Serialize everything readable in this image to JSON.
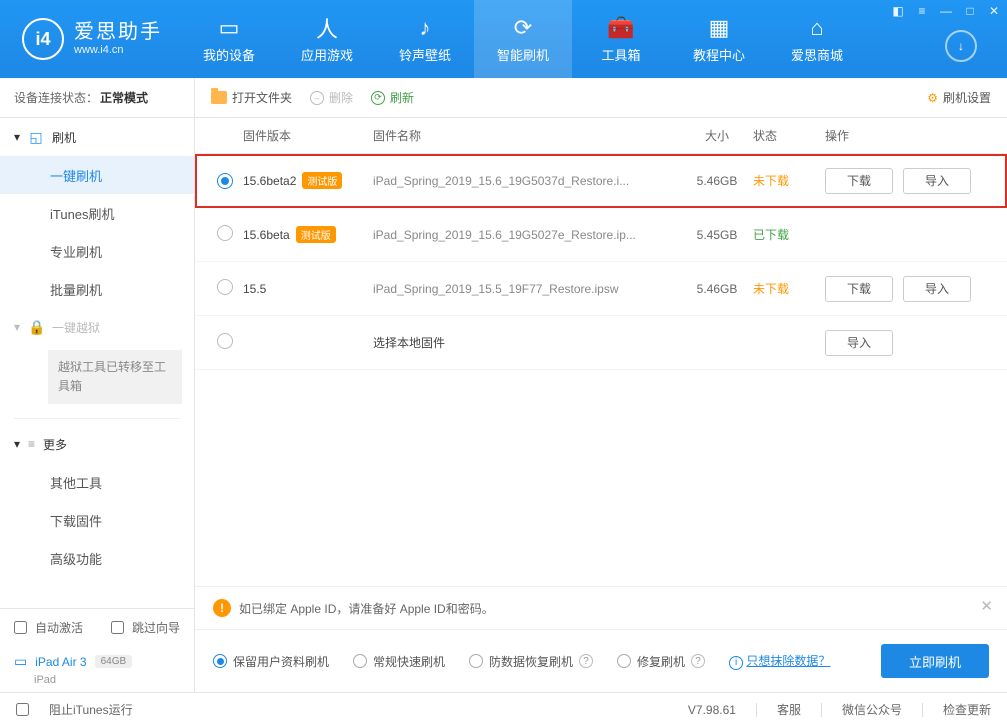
{
  "app": {
    "name_cn": "爱思助手",
    "name_en": "www.i4.cn"
  },
  "nav": [
    {
      "icon": "▭",
      "label": "我的设备"
    },
    {
      "icon": "人",
      "label": "应用游戏"
    },
    {
      "icon": "♪",
      "label": "铃声壁纸"
    },
    {
      "icon": "⟳",
      "label": "智能刷机",
      "active": true
    },
    {
      "icon": "🧰",
      "label": "工具箱"
    },
    {
      "icon": "▦",
      "label": "教程中心"
    },
    {
      "icon": "⌂",
      "label": "爱思商城"
    }
  ],
  "sidebar": {
    "conn_label": "设备连接状态：",
    "conn_value": "正常模式",
    "group1": {
      "icon": "↻",
      "label": "刷机"
    },
    "items1": [
      "一键刷机",
      "iTunes刷机",
      "专业刷机",
      "批量刷机"
    ],
    "group2": {
      "label": "一键越狱"
    },
    "note": "越狱工具已转移至工具箱",
    "group3": {
      "label": "更多"
    },
    "items3": [
      "其他工具",
      "下载固件",
      "高级功能"
    ],
    "check1": "自动激活",
    "check2": "跳过向导",
    "device_name": "iPad Air 3",
    "device_badge": "64GB",
    "device_type": "iPad"
  },
  "toolbar": {
    "open": "打开文件夹",
    "delete": "删除",
    "refresh": "刷新",
    "settings": "刷机设置"
  },
  "thead": {
    "ver": "固件版本",
    "name": "固件名称",
    "size": "大小",
    "status": "状态",
    "ops": "操作"
  },
  "rows": [
    {
      "selected": true,
      "highlight": true,
      "ver": "15.6beta2",
      "tag": "测试版",
      "name": "iPad_Spring_2019_15.6_19G5037d_Restore.i...",
      "size": "5.46GB",
      "status": "未下载",
      "status_cls": "orange",
      "btns": [
        "下载",
        "导入"
      ]
    },
    {
      "selected": false,
      "ver": "15.6beta",
      "tag": "测试版",
      "name": "iPad_Spring_2019_15.6_19G5027e_Restore.ip...",
      "size": "5.45GB",
      "status": "已下载",
      "status_cls": "green",
      "btns": []
    },
    {
      "selected": false,
      "ver": "15.5",
      "tag": "",
      "name": "iPad_Spring_2019_15.5_19F77_Restore.ipsw",
      "size": "5.46GB",
      "status": "未下载",
      "status_cls": "orange",
      "btns": [
        "下载",
        "导入"
      ]
    },
    {
      "selected": false,
      "ver": "",
      "tag": "",
      "local": true,
      "name": "选择本地固件",
      "size": "",
      "status": "",
      "btns": [
        "导入"
      ]
    }
  ],
  "info": "如已绑定 Apple ID，请准备好 Apple ID和密码。",
  "options": [
    "保留用户资料刷机",
    "常规快速刷机",
    "防数据恢复刷机",
    "修复刷机"
  ],
  "option_selected": 0,
  "option_helpers": [
    2,
    3
  ],
  "erase_link": "只想抹除数据？",
  "primary": "立即刷机",
  "statusbar": {
    "prevent": "阻止iTunes运行",
    "version": "V7.98.61",
    "k1": "客服",
    "k2": "微信公众号",
    "k3": "检查更新"
  }
}
